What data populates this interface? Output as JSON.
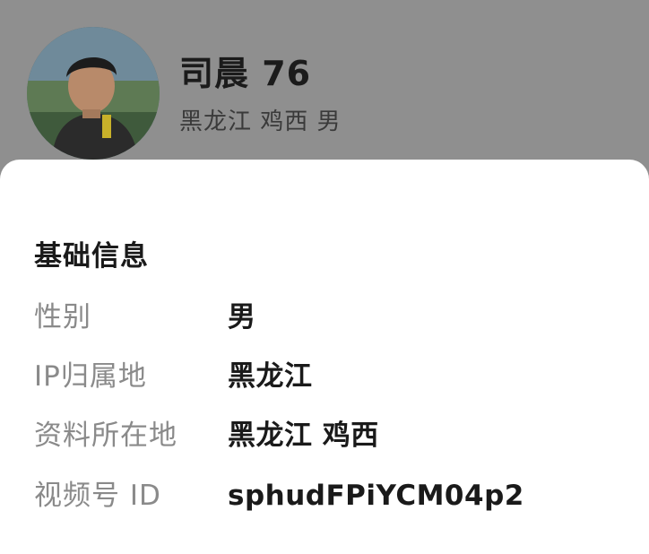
{
  "profile": {
    "name": "司晨 76",
    "subtitle": "黑龙江 鸡西 男"
  },
  "info": {
    "section_title": "基础信息",
    "rows": [
      {
        "label": "性别",
        "value": "男"
      },
      {
        "label": "IP归属地",
        "value": "黑龙江"
      },
      {
        "label": "资料所在地",
        "value": "黑龙江 鸡西"
      },
      {
        "label": "视频号 ID",
        "value": "sphudFPiYCM04p2"
      }
    ]
  },
  "colors": {
    "dimmed_background": "#8f8f8f",
    "sheet_background": "#ffffff",
    "label_text": "#8a8a8a",
    "value_text": "#1a1a1a"
  }
}
